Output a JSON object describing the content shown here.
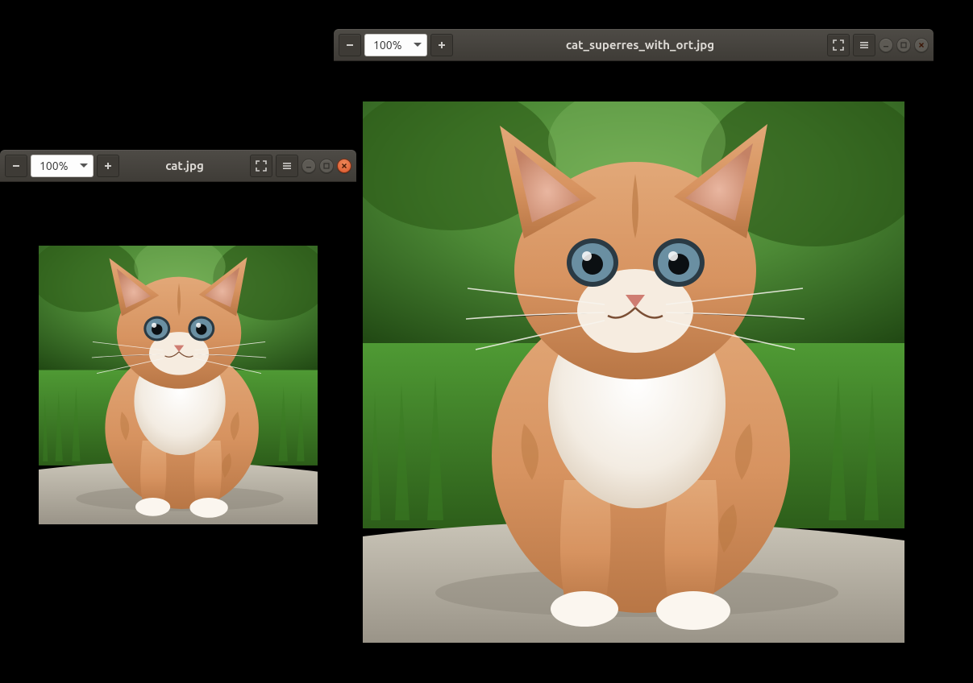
{
  "windows": [
    {
      "id": "win1",
      "title": "cat.jpg",
      "zoom": "100%",
      "active": true
    },
    {
      "id": "win2",
      "title": "cat_superres_with_ort.jpg",
      "zoom": "100%",
      "active": false
    }
  ],
  "icons": {
    "zoom_out": "−",
    "zoom_in": "+",
    "fullscreen": "⛶",
    "menu": "≡"
  }
}
